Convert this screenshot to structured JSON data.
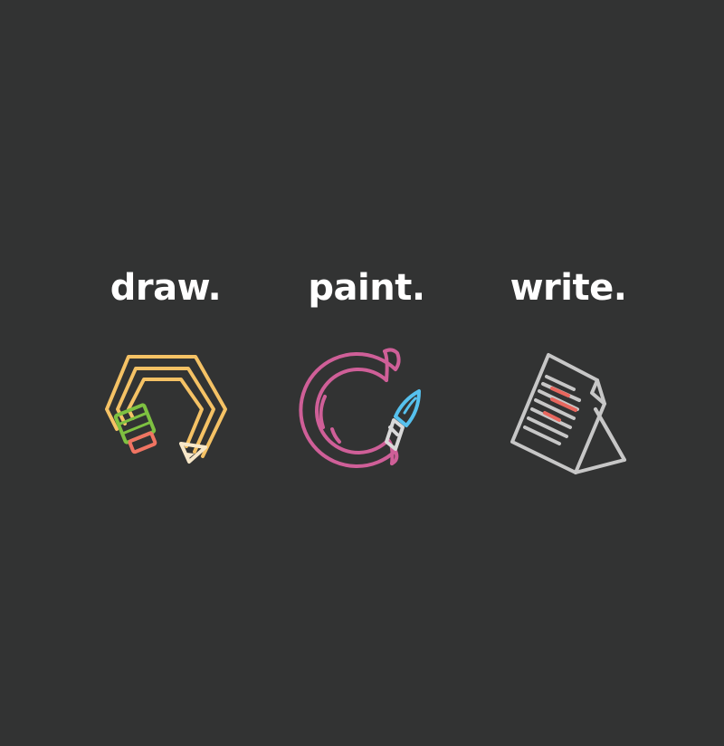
{
  "items": [
    {
      "label": "draw.",
      "icon": "pencil-hexagon-icon"
    },
    {
      "label": "paint.",
      "icon": "paintbrush-ring-icon"
    },
    {
      "label": "write.",
      "icon": "document-stand-icon"
    }
  ],
  "colors": {
    "background": "#323333",
    "label": "#ffffff",
    "pencil_body": "#f5c265",
    "pencil_band": "#7ec141",
    "pencil_eraser": "#f07462",
    "pencil_tip": "#f7e7c8",
    "brush_ring": "#cf5f98",
    "brush_tip": "#56c1ee",
    "brush_ferrule": "#d9d9d9",
    "document": "#c7c7c7",
    "document_highlight": "#e8675e"
  }
}
